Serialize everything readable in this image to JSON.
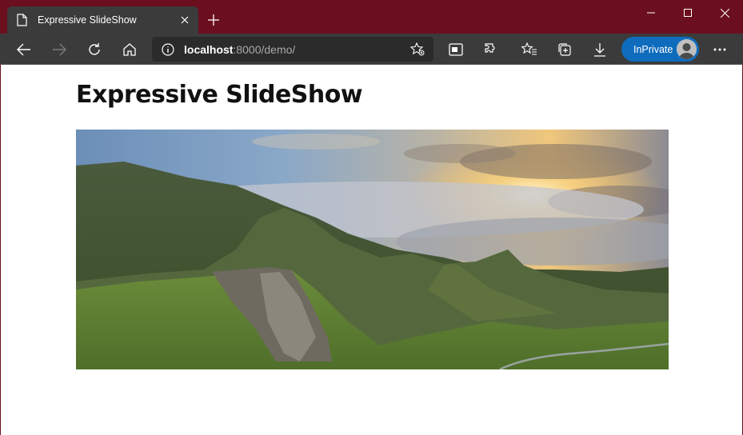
{
  "browser": {
    "tab_title": "Expressive SlideShow",
    "url_host": "localhost",
    "url_rest": ":8000/demo/",
    "inprivate_label": "InPrivate"
  },
  "page": {
    "title": "Expressive SlideShow"
  },
  "colors": {
    "titlebar": "#6b0f1f",
    "toolbar": "#3b3b3b",
    "inprivate": "#0f6cbd"
  }
}
